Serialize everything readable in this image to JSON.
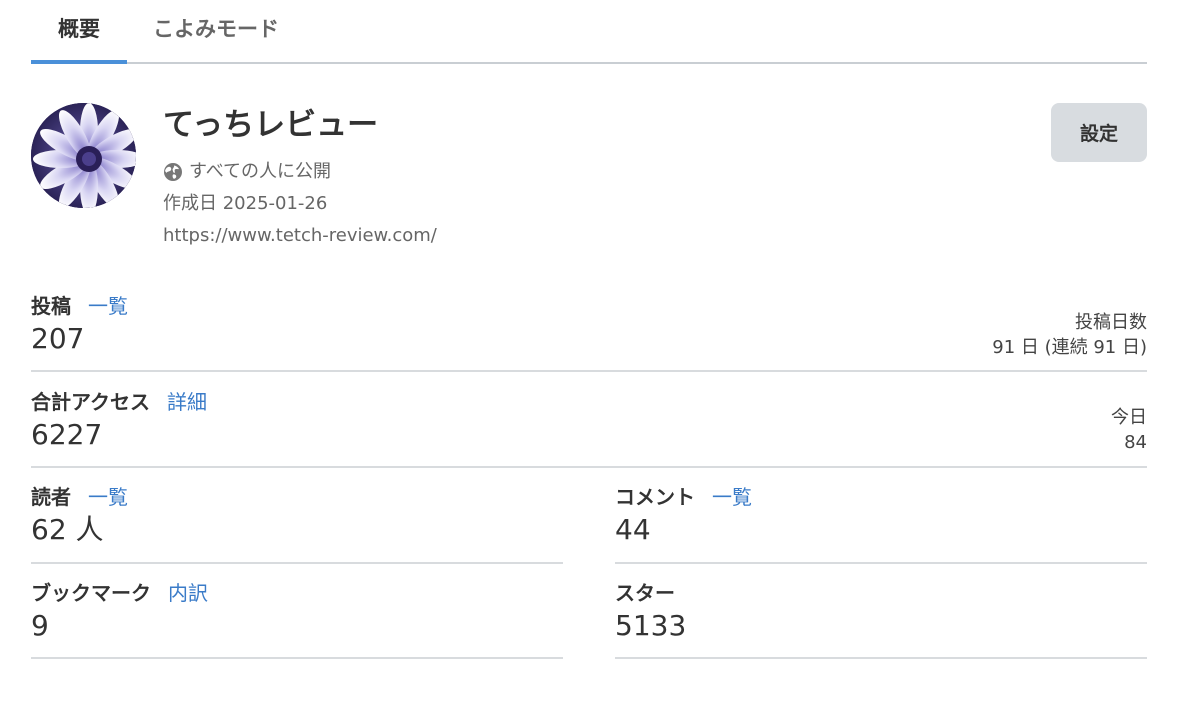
{
  "tabs": [
    {
      "label": "概要",
      "active": true
    },
    {
      "label": "こよみモード",
      "active": false
    }
  ],
  "profile": {
    "title": "てっちレビュー",
    "visibility": "すべての人に公開",
    "created": "作成日 2025-01-26",
    "url": "https://www.tetch-review.com/",
    "settings_label": "設定",
    "avatar_icon": "flower-avatar"
  },
  "stats": {
    "posts": {
      "label": "投稿",
      "link": "一覧",
      "value": "207",
      "side_label": "投稿日数",
      "side_value": "91 日 (連続 91 日)"
    },
    "access": {
      "label": "合計アクセス",
      "link": "詳細",
      "value": "6227",
      "side_label": "今日",
      "side_value": "84"
    },
    "readers": {
      "label": "読者",
      "link": "一覧",
      "value": "62 人"
    },
    "comments": {
      "label": "コメント",
      "link": "一覧",
      "value": "44"
    },
    "bookmarks": {
      "label": "ブックマーク",
      "link": "内訳",
      "value": "9"
    },
    "stars": {
      "label": "スター",
      "value": "5133"
    }
  },
  "colors": {
    "accent": "#4a90d9",
    "link": "#3a7bc8",
    "button_bg": "#d8dce0"
  }
}
